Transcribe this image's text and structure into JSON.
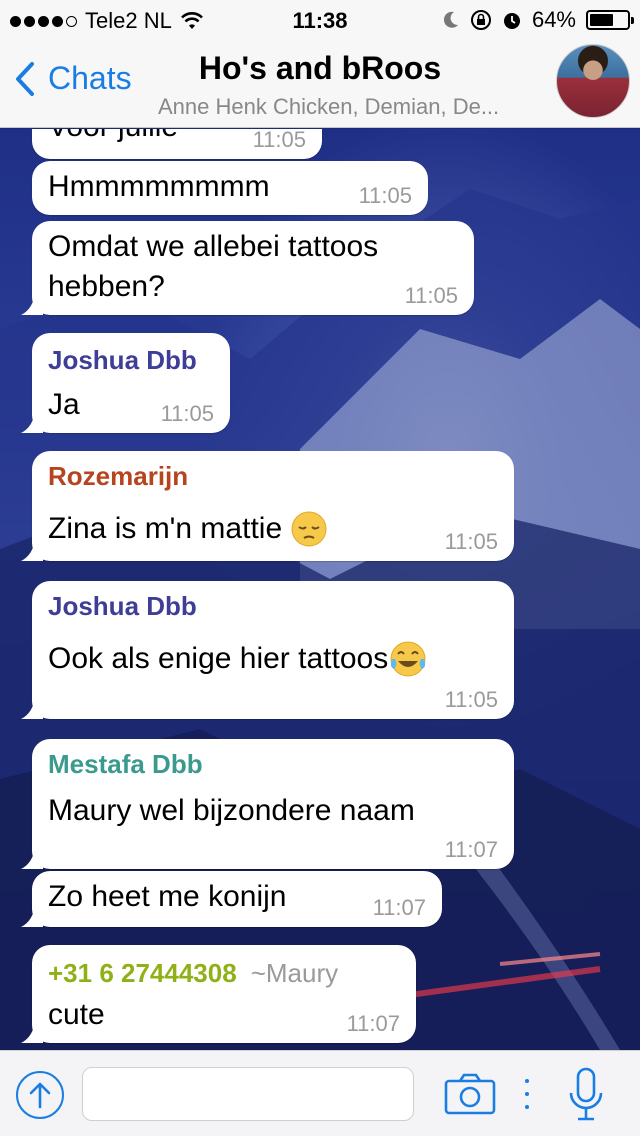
{
  "status_bar": {
    "carrier": "Tele2 NL",
    "time": "11:38",
    "battery": "64%",
    "battery_level": 0.64
  },
  "header": {
    "back_label": "Chats",
    "title": "Ho's and bRoos",
    "subtitle": "Anne Henk Chicken, Demian, De..."
  },
  "colors": {
    "accent": "#1a7de3",
    "joshua": "#3e3e96",
    "rozemarijn": "#b5441f",
    "mestafa": "#3a9a8c",
    "phone": "#8fb016"
  },
  "messages": [
    {
      "text": "Voor jullie",
      "time": "11:05"
    },
    {
      "text": "Hmmmmmmmm",
      "time": "11:05"
    },
    {
      "text_line1": "Omdat we allebei tattoos",
      "text_line2": "hebben?",
      "time": "11:05"
    },
    {
      "sender": "Joshua Dbb",
      "text": "Ja",
      "time": "11:05"
    },
    {
      "sender": "Rozemarijn",
      "text": "Zina is m'n mattie",
      "time": "11:05"
    },
    {
      "sender": "Joshua Dbb",
      "text": "Ook als enige hier tattoos",
      "time": "11:05"
    },
    {
      "sender": "Mestafa Dbb",
      "text": "Maury wel bijzondere naam",
      "time": "11:07"
    },
    {
      "text": "Zo heet me konijn",
      "time": "11:07"
    },
    {
      "sender": "+31 6 27444308",
      "sender_alias": "~Maury",
      "text": "cute",
      "time": "11:07"
    }
  ],
  "input": {
    "placeholder": ""
  },
  "icons": {
    "upload": "upload-icon",
    "camera": "camera-icon",
    "mic": "microphone-icon",
    "back": "chevron-left-icon"
  }
}
